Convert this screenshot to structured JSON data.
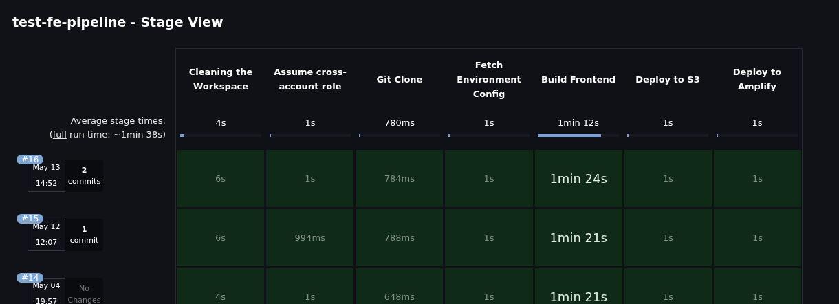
{
  "title": "test-fe-pipeline - Stage View",
  "stages": [
    "Cleaning the Workspace",
    "Assume cross-account role",
    "Git Clone",
    "Fetch Environment Config",
    "Build Frontend",
    "Deploy to S3",
    "Deploy to Amplify"
  ],
  "averages": {
    "label": "Average stage times:",
    "full_prefix": "(",
    "full_link": "full",
    "full_suffix": " run time: ~1min 38s)",
    "items": [
      {
        "text": "4s",
        "level": 0.05
      },
      {
        "text": "1s",
        "level": 0.02
      },
      {
        "text": "780ms",
        "level": 0.02
      },
      {
        "text": "1s",
        "level": 0.02
      },
      {
        "text": "1min 12s",
        "level": 0.78
      },
      {
        "text": "1s",
        "level": 0.02
      },
      {
        "text": "1s",
        "level": 0.02
      }
    ]
  },
  "builds": [
    {
      "number": "#16",
      "date": "May 13",
      "time": "14:52",
      "changes": {
        "kind": "commits",
        "count": "2",
        "label": "commits"
      },
      "cells": [
        {
          "text": "6s",
          "emphasized": false
        },
        {
          "text": "1s",
          "emphasized": false
        },
        {
          "text": "784ms",
          "emphasized": false
        },
        {
          "text": "1s",
          "emphasized": false
        },
        {
          "text": "1min 24s",
          "emphasized": true
        },
        {
          "text": "1s",
          "emphasized": false
        },
        {
          "text": "1s",
          "emphasized": false
        }
      ]
    },
    {
      "number": "#15",
      "date": "May 12",
      "time": "12:07",
      "changes": {
        "kind": "commits",
        "count": "1",
        "label": "commit"
      },
      "cells": [
        {
          "text": "6s",
          "emphasized": false
        },
        {
          "text": "994ms",
          "emphasized": false
        },
        {
          "text": "788ms",
          "emphasized": false
        },
        {
          "text": "1s",
          "emphasized": false
        },
        {
          "text": "1min 21s",
          "emphasized": true
        },
        {
          "text": "1s",
          "emphasized": false
        },
        {
          "text": "1s",
          "emphasized": false
        }
      ]
    },
    {
      "number": "#14",
      "date": "May 04",
      "time": "19:57",
      "changes": {
        "kind": "none",
        "label": "No Changes"
      },
      "cells": [
        {
          "text": "4s",
          "emphasized": false
        },
        {
          "text": "1s",
          "emphasized": false
        },
        {
          "text": "648ms",
          "emphasized": false
        },
        {
          "text": "1s",
          "emphasized": false
        },
        {
          "text": "1min 21s",
          "emphasized": true
        },
        {
          "text": "1s",
          "emphasized": false
        },
        {
          "text": "1s",
          "emphasized": false
        }
      ]
    }
  ]
}
